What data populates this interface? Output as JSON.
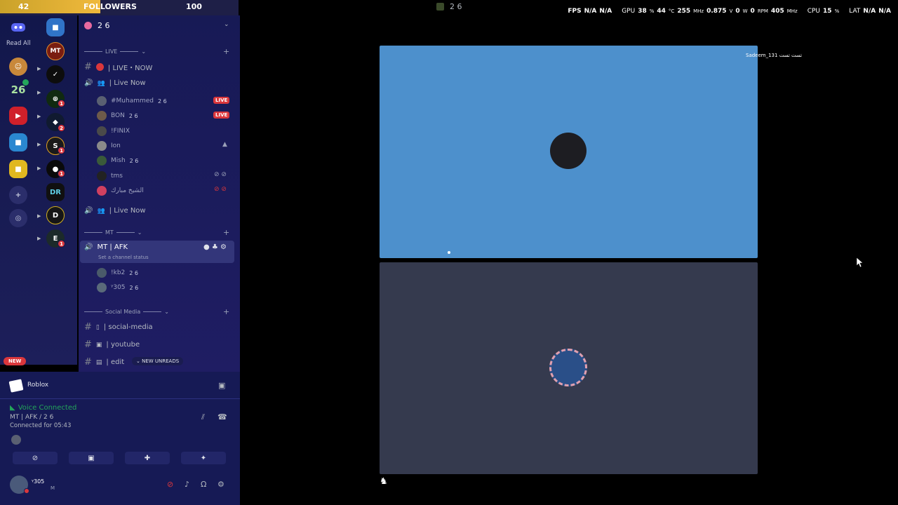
{
  "overlay": {
    "followers_current": "42",
    "followers_label": "FOLLOWERS",
    "followers_goal": "100",
    "fill_fraction": 0.42
  },
  "topbar": {
    "server_name": "2 6"
  },
  "perf": {
    "fps_label": "FPS",
    "fps_value": "N/A",
    "fps_value2": "N/A",
    "gpu_label": "GPU",
    "gpu_load": "38",
    "gpu_temp": "44",
    "gpu_clock": "255",
    "gpu_volt": "0.875",
    "gpu_power": "0",
    "gpu_fan": "0",
    "gpu_mem": "405",
    "cpu_label": "CPU",
    "cpu_load": "15",
    "lat_label": "LAT",
    "lat_value": "N/A",
    "lat_value2": "N/A"
  },
  "rail": {
    "read_all": "Read All",
    "server_26": "26",
    "badge_1": "1",
    "badge_2": "2",
    "mt": "MT",
    "dr": "DR"
  },
  "channel_header": {
    "name": "2 6"
  },
  "categories": {
    "live": "LIVE",
    "mt": "MT",
    "social": "Social Media"
  },
  "channels": {
    "live_now_text": "| LIVE・NOW",
    "live_now_voice": "| Live Now",
    "live_now_voice2": "| Live Now",
    "mt_afk": "MT | AFK",
    "set_status": "Set a channel status",
    "social_media": "| social-media",
    "youtube": "| youtube",
    "edit": "| edit",
    "new_unreads": "NEW UNREADS"
  },
  "users": [
    {
      "name": "#Muhammed",
      "tag": "2 6",
      "live": "LIVE"
    },
    {
      "name": "BON",
      "tag": "2 6",
      "live": "LIVE"
    },
    {
      "name": "!FINIX",
      "tag": "",
      "live": ""
    },
    {
      "name": "Ion",
      "tag": "",
      "live": ""
    },
    {
      "name": "Mish",
      "tag": "2 6",
      "live": ""
    },
    {
      "name": "tms",
      "tag": "",
      "live": ""
    },
    {
      "name": "الشيخ مبارك",
      "tag": "",
      "live": ""
    }
  ],
  "afk_users": [
    {
      "name": "!kb2",
      "tag": "2 6"
    },
    {
      "name": "ᵞ305",
      "tag": "2 6"
    }
  ],
  "new_pill": "NEW",
  "activity": {
    "game": "Roblox"
  },
  "voice": {
    "status": "Voice Connected",
    "channel": "MT | AFK / 2 6",
    "duration": "Connected for 05:43"
  },
  "account": {
    "username": "ᵞ305",
    "status": "M"
  },
  "stage": {
    "participant_name": "Sadeem_131 تست تست"
  },
  "colors": {
    "accent_red": "#da373c",
    "stage_blue": "#4d90cc",
    "voice_green": "#23a55a"
  }
}
